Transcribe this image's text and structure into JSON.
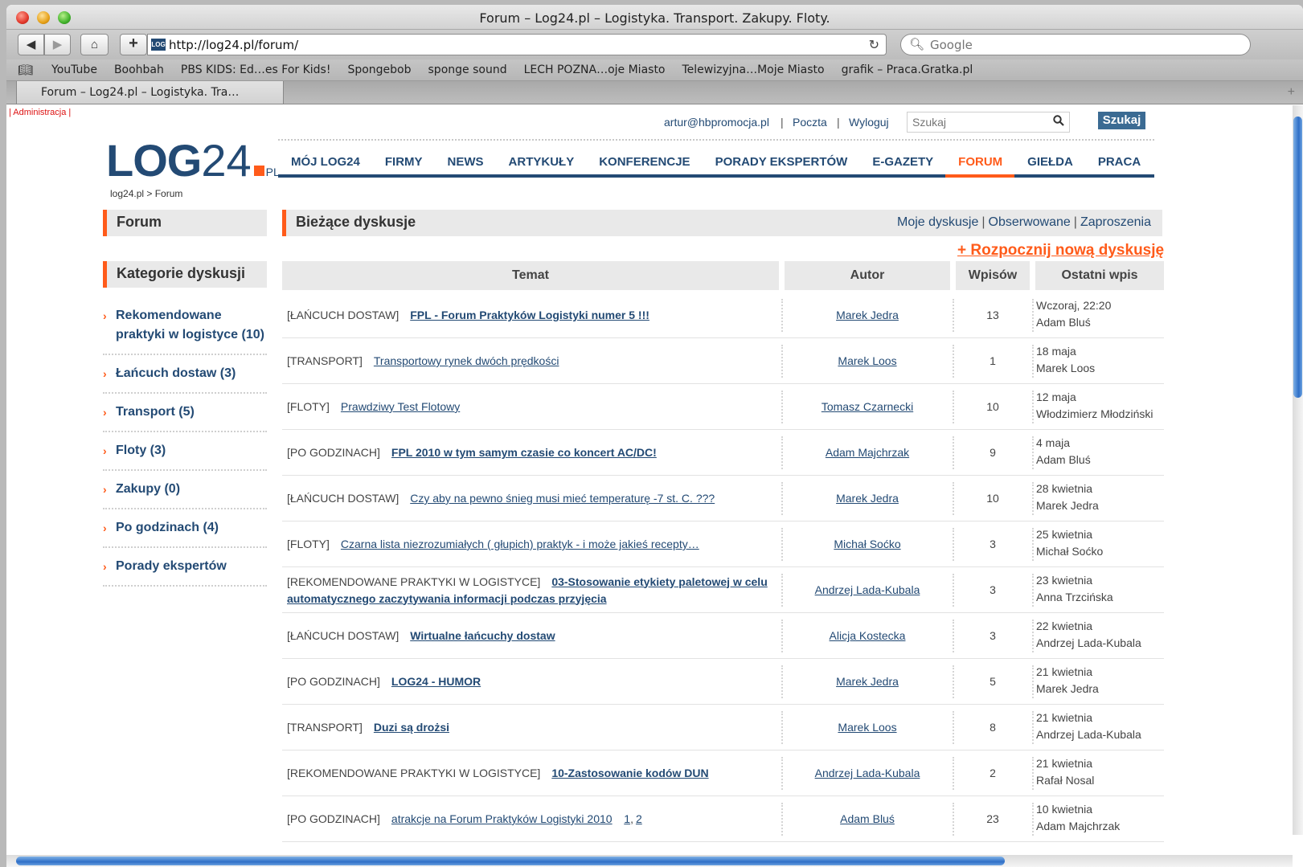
{
  "window": {
    "title": "Forum – Log24.pl – Logistyka. Transport. Zakupy. Floty."
  },
  "toolbar": {
    "url": "http://log24.pl/forum/",
    "search_placeholder": "Google",
    "favicon_text": "LOG"
  },
  "bookmarks": [
    "YouTube",
    "Boohbah",
    "PBS KIDS: Ed…es For Kids!",
    "Spongebob",
    "sponge sound",
    "LECH POZNA…oje Miasto",
    "Telewizyjna…Moje Miasto",
    "grafik – Praca.Gratka.pl"
  ],
  "tab": {
    "label": "Forum – Log24.pl – Logistyka. Tra…"
  },
  "page": {
    "admin_link": "| Administracja |",
    "top": {
      "email": "artur@hbpromocja.pl",
      "poczta": "Poczta",
      "wyloguj": "Wyloguj",
      "search_placeholder": "Szukaj",
      "search_button": "Szukaj"
    },
    "logo": {
      "log": "LOG",
      "num": "24",
      "pl": "PL"
    },
    "nav": [
      "MÓJ LOG24",
      "FIRMY",
      "NEWS",
      "ARTYKUŁY",
      "KONFERENCJE",
      "PORADY EKSPERTÓW",
      "E-GAZETY",
      "FORUM",
      "GIEŁDA",
      "PRACA"
    ],
    "nav_active": "FORUM",
    "breadcrumb": "log24.pl > Forum",
    "forum_heading": "Forum",
    "discussions_heading": "Bieżące dyskusje",
    "sublinks": {
      "moje": "Moje dyskusje",
      "obserwowane": "Obserwowane",
      "zaproszenia": "Zaproszenia"
    },
    "new_discussion": "+ Rozpocznij nową dyskusję",
    "categories_heading": "Kategorie dyskusji",
    "categories": [
      "Rekomendowane praktyki w logistyce (10)",
      "Łańcuch dostaw (3)",
      "Transport (5)",
      "Floty (3)",
      "Zakupy (0)",
      "Po godzinach (4)",
      "Porady ekspertów"
    ],
    "table": {
      "headers": {
        "temat": "Temat",
        "autor": "Autor",
        "wpisow": "Wpisów",
        "ostatni": "Ostatni wpis"
      },
      "rows": [
        {
          "cat": "[ŁAŃCUCH DOSTAW]",
          "topic": "FPL - Forum Praktyków Logistyki numer 5 !!!",
          "bold": true,
          "author": "Marek Jedra",
          "count": "13",
          "date": "Wczoraj, 22:20",
          "last": "Adam Bluś"
        },
        {
          "cat": "[TRANSPORT]",
          "topic": "Transportowy rynek dwóch prędkości",
          "bold": false,
          "author": "Marek Loos",
          "count": "1",
          "date": "18 maja",
          "last": "Marek Loos"
        },
        {
          "cat": "[FLOTY]",
          "topic": "Prawdziwy Test Flotowy",
          "bold": false,
          "author": "Tomasz Czarnecki",
          "count": "10",
          "date": "12 maja",
          "last": "Włodzimierz Młodziński"
        },
        {
          "cat": "[PO GODZINACH]",
          "topic": "FPL 2010 w tym samym czasie co koncert AC/DC!",
          "bold": true,
          "author": "Adam Majchrzak",
          "count": "9",
          "date": "4 maja",
          "last": "Adam Bluś"
        },
        {
          "cat": "[ŁAŃCUCH DOSTAW]",
          "topic": "Czy aby na pewno śnieg musi mieć temperaturę -7 st. C. ???",
          "bold": false,
          "author": "Marek Jedra",
          "count": "10",
          "date": "28 kwietnia",
          "last": "Marek Jedra"
        },
        {
          "cat": "[FLOTY]",
          "topic": "Czarna lista niezrozumiałych ( głupich) praktyk - i może jakieś recepty…",
          "bold": false,
          "author": "Michał Soćko",
          "count": "3",
          "date": "25 kwietnia",
          "last": "Michał Soćko"
        },
        {
          "cat": "[REKOMENDOWANE PRAKTYKI W LOGISTYCE]",
          "topic": "03-Stosowanie etykiety paletowej w celu automatycznego zaczytywania informacji podczas przyjęcia",
          "bold": true,
          "author": "Andrzej Lada-Kubala",
          "count": "3",
          "date": "23 kwietnia",
          "last": "Anna Trzcińska"
        },
        {
          "cat": "[ŁAŃCUCH DOSTAW]",
          "topic": "Wirtualne łańcuchy dostaw",
          "bold": true,
          "author": "Alicja Kostecka",
          "count": "3",
          "date": "22 kwietnia",
          "last": "Andrzej Lada-Kubala"
        },
        {
          "cat": "[PO GODZINACH]",
          "topic": "LOG24 - HUMOR",
          "bold": true,
          "author": "Marek Jedra",
          "count": "5",
          "date": "21 kwietnia",
          "last": "Marek Jedra"
        },
        {
          "cat": "[TRANSPORT]",
          "topic": "Duzi są drożsi",
          "bold": true,
          "author": "Marek Loos",
          "count": "8",
          "date": "21 kwietnia",
          "last": "Andrzej Lada-Kubala"
        },
        {
          "cat": "[REKOMENDOWANE PRAKTYKI W LOGISTYCE]",
          "topic": "10-Zastosowanie kodów DUN",
          "bold": true,
          "author": "Andrzej Lada-Kubala",
          "count": "2",
          "date": "21 kwietnia",
          "last": "Rafał Nosal"
        },
        {
          "cat": "[PO GODZINACH]",
          "topic": "atrakcje na Forum Praktyków Logistyki 2010",
          "bold": false,
          "author": "Adam Bluś",
          "count": "23",
          "date": "10 kwietnia",
          "last": "Adam Majchrzak",
          "pages": [
            "1",
            "2"
          ]
        }
      ]
    }
  }
}
